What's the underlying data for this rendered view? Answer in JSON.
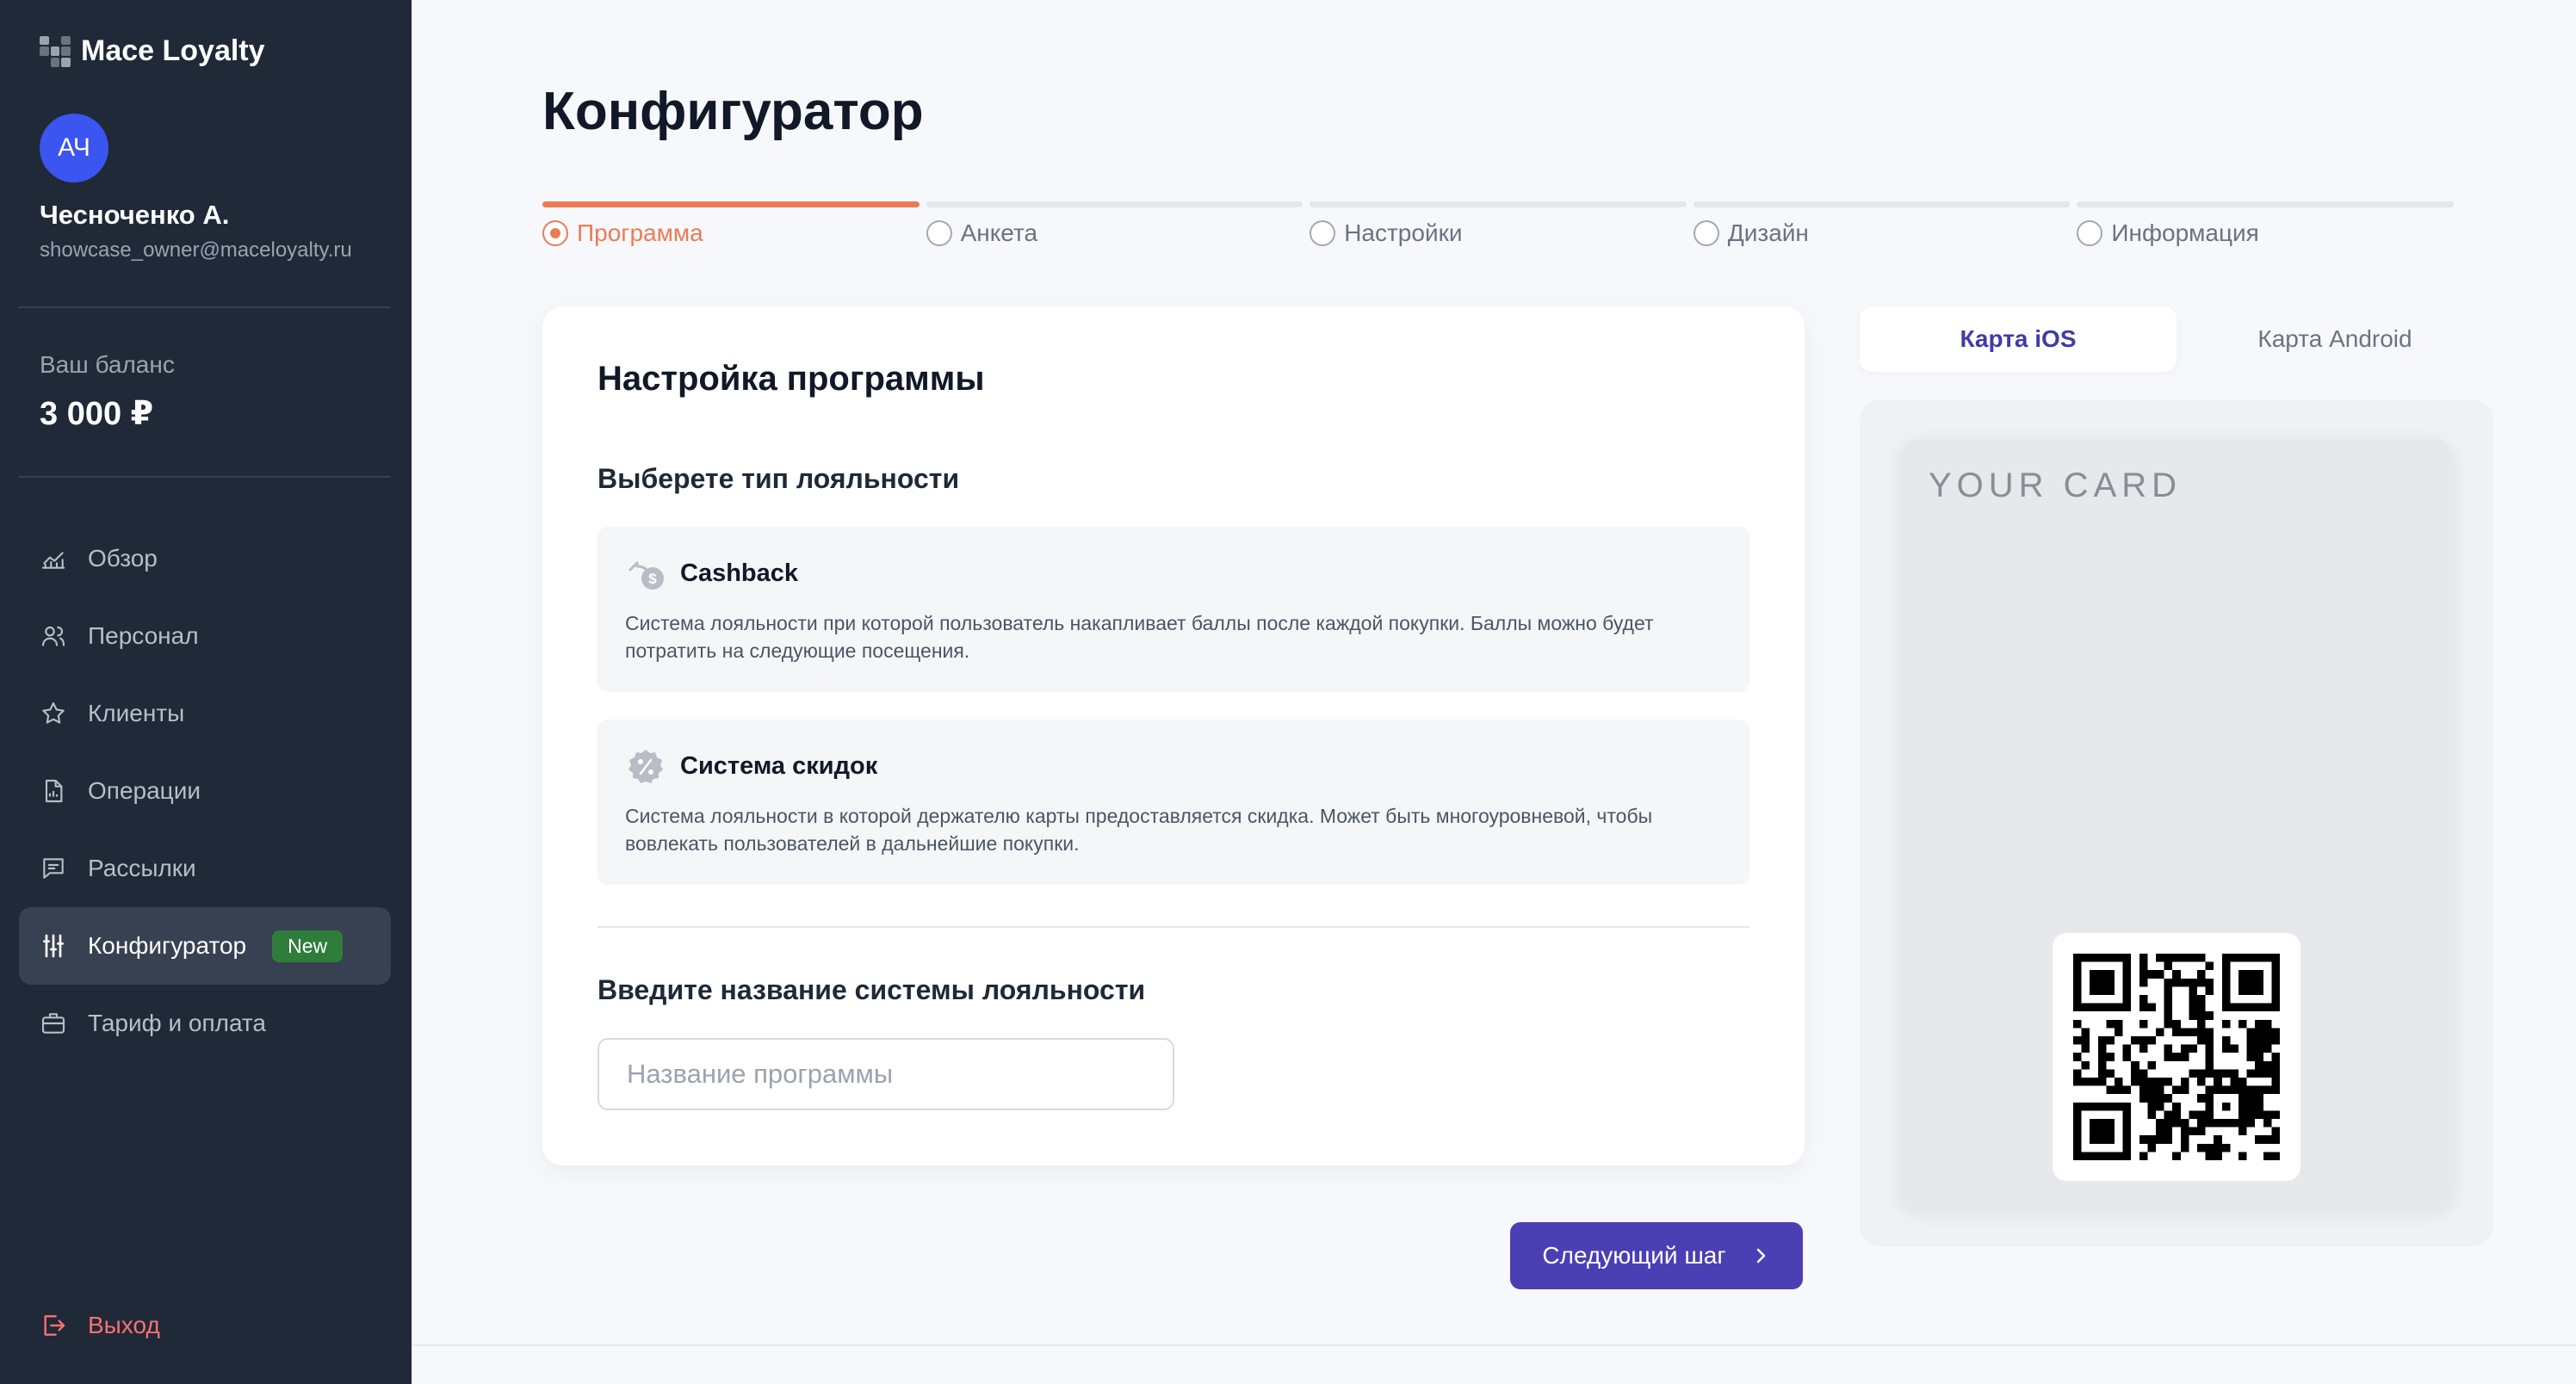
{
  "app": {
    "name": "Mace Loyalty"
  },
  "user": {
    "initials": "АЧ",
    "name": "Чесноченко А.",
    "email": "showcase_owner@maceloyalty.ru"
  },
  "balance": {
    "label": "Ваш баланс",
    "value": "3 000 ₽"
  },
  "nav": {
    "items": [
      {
        "label": "Обзор",
        "icon": "chart-icon"
      },
      {
        "label": "Персонал",
        "icon": "users-icon"
      },
      {
        "label": "Клиенты",
        "icon": "star-icon"
      },
      {
        "label": "Операции",
        "icon": "document-icon"
      },
      {
        "label": "Рассылки",
        "icon": "message-icon"
      },
      {
        "label": "Конфигуратор",
        "icon": "sliders-icon",
        "active": true,
        "badge": "New"
      },
      {
        "label": "Тариф и оплата",
        "icon": "briefcase-icon"
      }
    ],
    "logout": "Выход"
  },
  "page": {
    "title": "Конфигуратор"
  },
  "steps": [
    {
      "label": "Программа",
      "active": true
    },
    {
      "label": "Анкета"
    },
    {
      "label": "Настройки"
    },
    {
      "label": "Дизайн"
    },
    {
      "label": "Информация"
    }
  ],
  "form": {
    "title": "Настройка программы",
    "type_heading": "Выберете тип лояльности",
    "options": [
      {
        "icon": "cashback-icon",
        "title": "Cashback",
        "description": "Система лояльности при которой пользователь накапливает баллы после каждой покупки. Баллы можно будет потратить на следующие посещения."
      },
      {
        "icon": "discount-icon",
        "title": "Система скидок",
        "description": "Система лояльности в которой держателю карты предоставляется скидка. Может быть многоуровневой, чтобы вовлекать пользователей в дальнейшие покупки."
      }
    ],
    "name_heading": "Введите название системы лояльности",
    "name_placeholder": "Название программы",
    "name_value": ""
  },
  "next_button": "Следующий шаг",
  "preview": {
    "tabs": [
      {
        "label": "Карта iOS",
        "active": true
      },
      {
        "label": "Карта Android"
      }
    ],
    "card_title": "YOUR CARD"
  },
  "colors": {
    "sidebar": "#1f2937",
    "accent_orange": "#ec7b55",
    "primary": "#4a3fb3",
    "badge_green": "#2f7d3a",
    "logout_red": "#f87171"
  }
}
